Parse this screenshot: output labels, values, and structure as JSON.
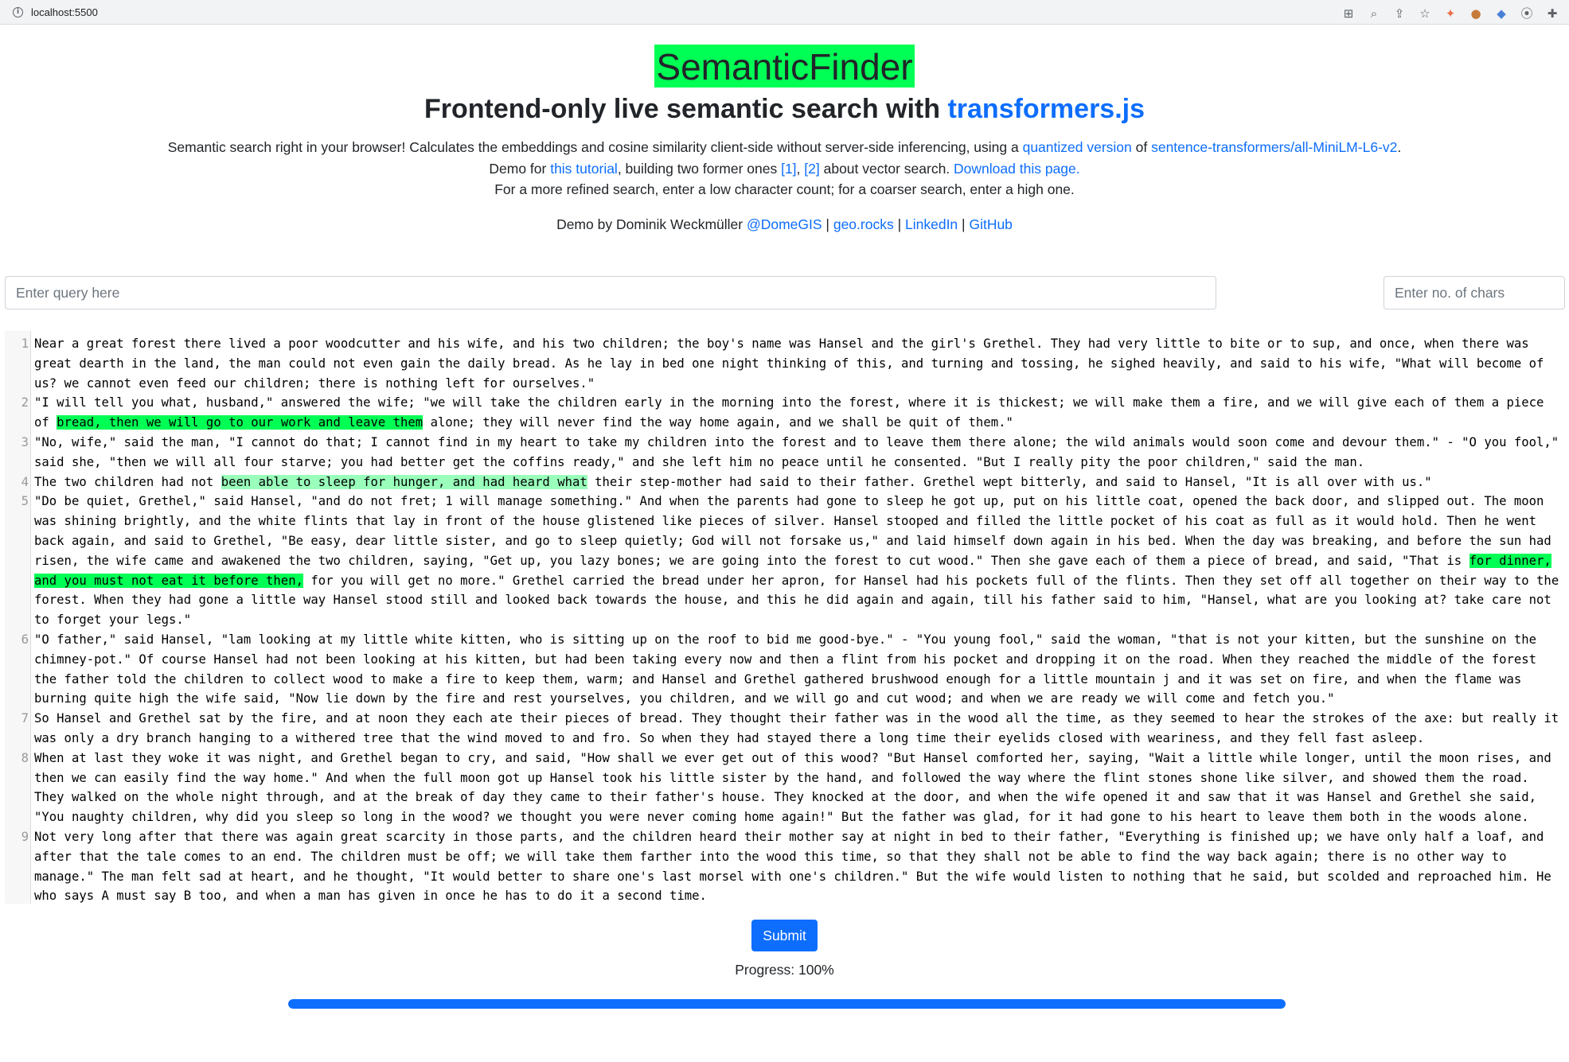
{
  "browser": {
    "url": "localhost:5500"
  },
  "header": {
    "title": "SemanticFinder",
    "subtitle_prefix": "Frontend-only live semantic search with ",
    "subtitle_link": "transformers.js",
    "desc_line1_a": "Semantic search right in your browser! Calculates the embeddings and cosine similarity client-side without server-side inferencing, using a ",
    "desc_line1_link1": "quantized version",
    "desc_line1_b": " of ",
    "desc_line1_link2": "sentence-transformers/all-MiniLM-L6-v2",
    "desc_line1_c": ".",
    "desc_line2_a": "Demo for ",
    "desc_line2_link1": "this tutorial",
    "desc_line2_b": ", building two former ones ",
    "desc_line2_link2": "[1]",
    "desc_line2_c": ", ",
    "desc_line2_link3": "[2]",
    "desc_line2_d": " about vector search. ",
    "desc_line2_link4": "Download this page.",
    "desc_line3": "For a more refined search, enter a low character count; for a coarser search, enter a high one.",
    "credits_prefix": "Demo by Dominik Weckmüller ",
    "credits_links": [
      "@DomeGIS",
      "geo.rocks",
      "LinkedIn",
      "GitHub"
    ],
    "credits_sep": " | "
  },
  "inputs": {
    "query_placeholder": "Enter query here",
    "chars_placeholder": "Enter no. of chars"
  },
  "editor": {
    "lines": [
      {
        "n": "1",
        "a": "Near a great forest there lived a poor woodcutter and his wife, and his two children; the boy's name was Hansel and the girl's Grethel. They had very little to bite or to sup, and once, when there was great dearth in the land, the man could not even gain the daily bread. As he lay in bed one night thinking of this, and turning and tossing, he sighed heavily, and said to his wife, \"What will become of us? we cannot even feed our children; there is nothing left for ourselves.\"",
        "h": "",
        "b": "",
        "h2": "",
        "c": ""
      },
      {
        "n": "2",
        "a": "\"I will tell you what, husband,\" answered the wife; \"we will take the children early in the morning into the forest, where it is thickest; we will make them a fire, and we will give each of them a piece of ",
        "h": "bread, then we will go to our work and leave them",
        "b": " alone; they will never find the way home again, and we shall be quit of them.\"",
        "h2": "",
        "c": ""
      },
      {
        "n": "3",
        "a": "\"No, wife,\" said the man, \"I cannot do that; I cannot find in my heart to take my children into the forest and to leave them there alone; the wild animals would soon come and devour them.\" - \"O you fool,\" said she, \"then we will all four starve; you had better get the coffins ready,\" and she left him no peace until he consented. \"But I really pity the poor children,\" said the man.",
        "h": "",
        "b": "",
        "h2": "",
        "c": ""
      },
      {
        "n": "4",
        "a": "The two children had not ",
        "hl": "been able to sleep for hunger, and had heard what",
        "b": " their step-mother had said to their father. Grethel wept bitterly, and said to Hansel, \"It is all over with us.\"",
        "h": "",
        "h2": "",
        "c": ""
      },
      {
        "n": "5",
        "a": "\"Do be quiet, Grethel,\" said Hansel, \"and do not fret; 1 will manage something.\" And when the parents had gone to sleep he got up, put on his little coat, opened the back door, and slipped out. The moon was shining brightly, and the white flints that lay in front of the house glistened like pieces of silver. Hansel stooped and filled the little pocket of his coat as full as it would hold. Then he went back again, and said to Grethel, \"Be easy, dear little sister, and go to sleep quietly; God will not forsake us,\" and laid himself down again in his bed. When the day was breaking, and before the sun had risen, the wife came and awakened the two children, saying, \"Get up, you lazy bones; we are going into the forest to cut wood.\" Then she gave each of them a piece of bread, and said, \"That is ",
        "h": "for dinner, and you must not eat it before then,",
        "b": " for you will get no more.\" Grethel carried the bread under her apron, for Hansel had his pockets full of the flints. Then they set off all together on their way to the forest. When they had gone a little way Hansel stood still and looked back towards the house, and this he did again and again, till his father said to him, \"Hansel, what are you looking at? take care not to forget your legs.\"",
        "h2": "",
        "c": ""
      },
      {
        "n": "6",
        "a": "\"O father,\" said Hansel, \"lam looking at my little white kitten, who is sitting up on the roof to bid me good-bye.\" - \"You young fool,\" said the woman, \"that is not your kitten, but the sunshine on the chimney-pot.\" Of course Hansel had not been looking at his kitten, but had been taking every now and then a flint from his pocket and dropping it on the road. When they reached the middle of the forest the father told the children to collect wood to make a fire to keep them, warm; and Hansel and Grethel gathered brushwood enough for a little mountain j and it was set on fire, and when the flame was burning quite high the wife said, \"Now lie down by the fire and rest yourselves, you children, and we will go and cut wood; and when we are ready we will come and fetch you.\"",
        "h": "",
        "b": "",
        "h2": "",
        "c": ""
      },
      {
        "n": "7",
        "a": "So Hansel and Grethel sat by the fire, and at noon they each ate their pieces of bread. They thought their father was in the wood all the time, as they seemed to hear the strokes of the axe: but really it was only a dry branch hanging to a withered tree that the wind moved to and fro. So when they had stayed there a long time their eyelids closed with weariness, and they fell fast asleep.",
        "h": "",
        "b": "",
        "h2": "",
        "c": ""
      },
      {
        "n": "8",
        "a": "When at last they woke it was night, and Grethel began to cry, and said, \"How shall we ever get out of this wood? \"But Hansel comforted her, saying, \"Wait a little while longer, until the moon rises, and then we can easily find the way home.\" And when the full moon got up Hansel took his little sister by the hand, and followed the way where the flint stones shone like silver, and showed them the road. They walked on the whole night through, and at the break of day they came to their father's house. They knocked at the door, and when the wife opened it and saw that it was Hansel and Grethel she said, \"You naughty children, why did you sleep so long in the wood? we thought you were never coming home again!\" But the father was glad, for it had gone to his heart to leave them both in the woods alone.",
        "h": "",
        "b": "",
        "h2": "",
        "c": ""
      },
      {
        "n": "9",
        "a": "Not very long after that there was again great scarcity in those parts, and the children heard their mother say at night in bed to their father, \"Everything is finished up; we have only half a loaf, and after that the tale comes to an end. The children must be off; we will take them farther into the wood this time, so that they shall not be able to find the way back again; there is no other way to manage.\" The man felt sad at heart, and he thought, \"It would better to share one's last morsel with one's children.\" But the wife would listen to nothing that he said, but scolded and reproached him. He who says A must say B too, and when a man has given in once he has to do it a second time.",
        "h": "",
        "b": "",
        "h2": "",
        "c": ""
      }
    ]
  },
  "actions": {
    "submit_label": "Submit",
    "progress_label": "Progress: 100%",
    "progress_value": 1.0
  },
  "colors": {
    "accent": "#0d6efd",
    "highlight": "#00ff55",
    "highlight_light": "#99ffbb"
  }
}
